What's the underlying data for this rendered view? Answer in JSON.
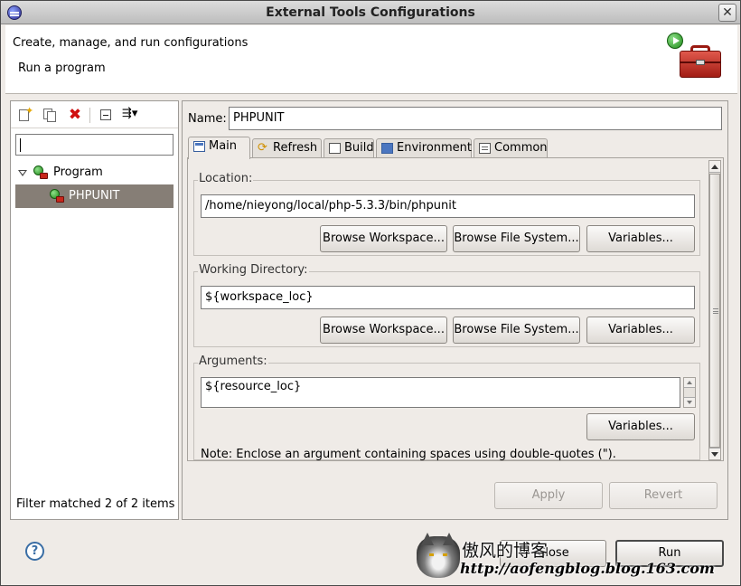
{
  "window": {
    "title": "External Tools Configurations",
    "close_glyph": "✕",
    "icon": "eclipse-icon"
  },
  "header": {
    "heading": "Create, manage, and run configurations",
    "message": "Run a program",
    "icon": "toolbox-run-icon"
  },
  "left_toolbar": {
    "icons": [
      "new-configuration-icon",
      "duplicate-icon",
      "delete-icon",
      "collapse-all-icon",
      "filter-menu-icon"
    ],
    "delete_glyph": "✖",
    "filter_glyph": "⇶▾"
  },
  "filter_input": {
    "value": ""
  },
  "tree": {
    "category": {
      "label": "Program",
      "icon": "program-icon"
    },
    "configurations": [
      {
        "label": "PHPUNIT",
        "selected": true,
        "icon": "external-tool-icon"
      }
    ]
  },
  "filter_status": "Filter matched 2 of 2 items",
  "config": {
    "name_label": "Name:",
    "name_value": "PHPUNIT",
    "tabs": [
      {
        "label": "Main",
        "active": true
      },
      {
        "label": "Refresh",
        "active": false
      },
      {
        "label": "Build",
        "active": false
      },
      {
        "label": "Environment",
        "active": false
      },
      {
        "label": "Common",
        "active": false
      }
    ],
    "location": {
      "label": "Location:",
      "value": "/home/nieyong/local/php-5.3.3/bin/phpunit",
      "browse_workspace": "Browse Workspace...",
      "browse_file_system": "Browse File System...",
      "variables": "Variables..."
    },
    "working_directory": {
      "label": "Working Directory:",
      "value": "${workspace_loc}",
      "browse_workspace": "Browse Workspace...",
      "browse_file_system": "Browse File System...",
      "variables": "Variables..."
    },
    "arguments": {
      "label": "Arguments:",
      "value": "${resource_loc}",
      "variables": "Variables...",
      "note": "Note: Enclose an argument containing spaces using double-quotes (\")."
    },
    "apply_label": "Apply",
    "revert_label": "Revert"
  },
  "footer": {
    "help_glyph": "?",
    "close_label": "Close",
    "run_label": "Run"
  },
  "watermark": {
    "title": "傲风的博客",
    "url": "http://aofengblog.blog.163.com"
  },
  "colors": {
    "selection": "#867e76",
    "dialog_bg": "#efebe7",
    "delete": "#d01010"
  }
}
